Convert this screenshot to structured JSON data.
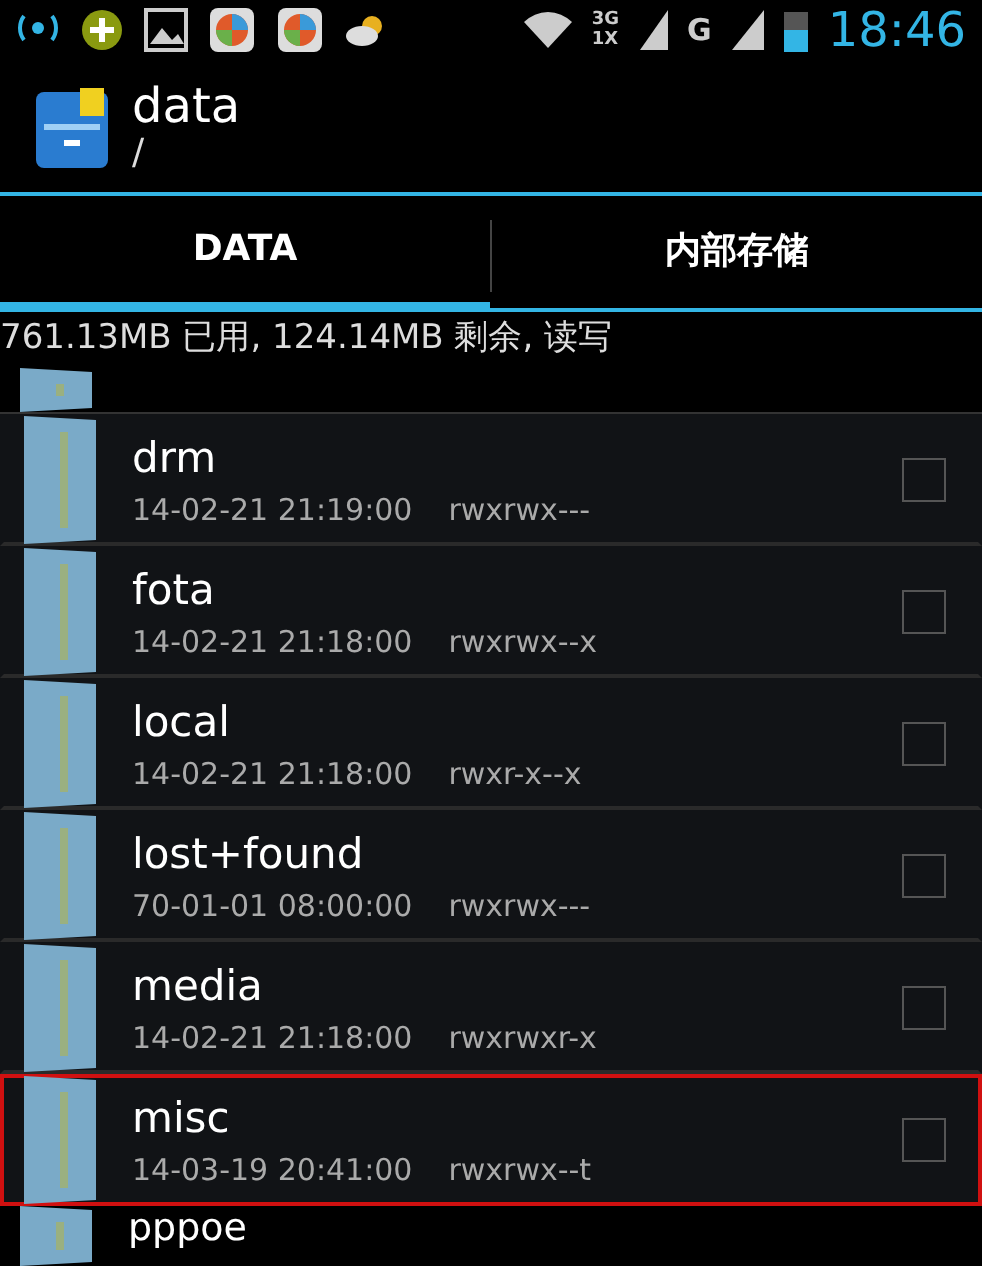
{
  "status_bar": {
    "network_top": "3G",
    "network_bottom": "1X",
    "network_second": "G",
    "time": "18:46"
  },
  "header": {
    "title": "data",
    "path": "/"
  },
  "tabs": [
    {
      "label": "DATA",
      "selected": true
    },
    {
      "label": "内部存储",
      "selected": false
    }
  ],
  "storage_info": "761.13MB 已用, 124.14MB 剩余, 读写",
  "files": [
    {
      "name": "drm",
      "date": "14-02-21 21:19:00",
      "permissions": "rwxrwx---",
      "checked": false,
      "highlighted": false
    },
    {
      "name": "fota",
      "date": "14-02-21 21:18:00",
      "permissions": "rwxrwx--x",
      "checked": false,
      "highlighted": false
    },
    {
      "name": "local",
      "date": "14-02-21 21:18:00",
      "permissions": "rwxr-x--x",
      "checked": false,
      "highlighted": false
    },
    {
      "name": "lost+found",
      "date": "70-01-01 08:00:00",
      "permissions": "rwxrwx---",
      "checked": false,
      "highlighted": false
    },
    {
      "name": "media",
      "date": "14-02-21 21:18:00",
      "permissions": "rwxrwxr-x",
      "checked": false,
      "highlighted": false
    },
    {
      "name": "misc",
      "date": "14-03-19 20:41:00",
      "permissions": "rwxrwx--t",
      "checked": false,
      "highlighted": true
    }
  ],
  "partial_file": {
    "name": "pppoe"
  }
}
